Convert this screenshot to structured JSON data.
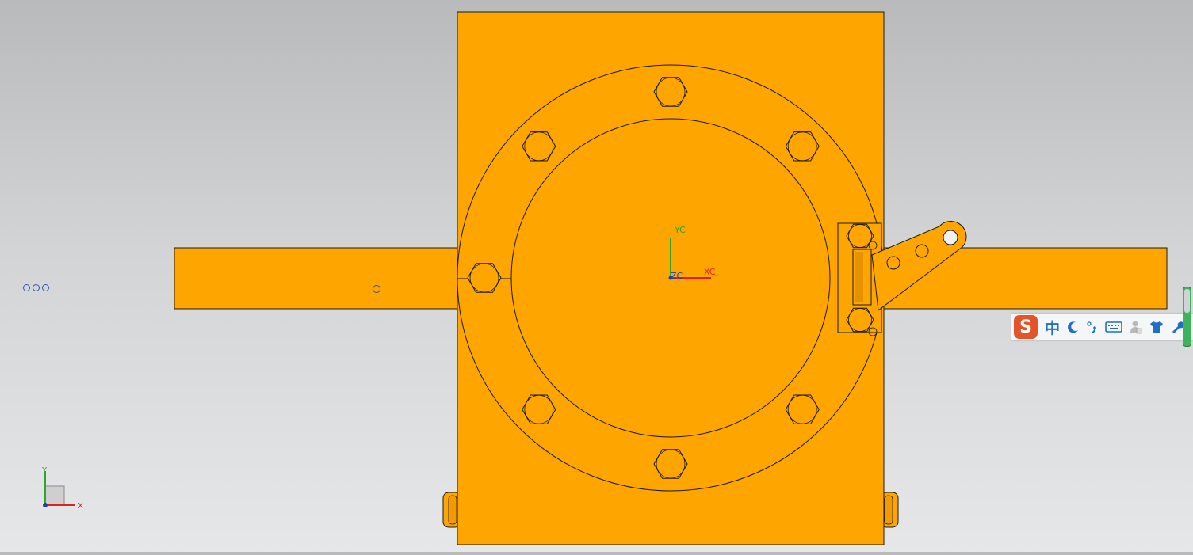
{
  "viewport": {
    "background_top": "#b9babb",
    "background_bottom": "#e6e7e8",
    "part_color": "#ffa500",
    "edge_color": "#1a1a1a"
  },
  "wcs_axes": {
    "x_label": "XC",
    "y_label": "YC",
    "z_label": "ZC",
    "x_color": "#e02020",
    "y_color": "#2ea62e",
    "z_color": "#1a3fb0"
  },
  "triad_axes": {
    "x_label": "X",
    "y_label": "Y"
  },
  "ime_toolbar": {
    "logo": "S",
    "lang": "中",
    "icons": [
      "moon-icon",
      "punctuation-icon",
      "keyboard-icon",
      "user-icon",
      "skin-shirt-icon",
      "wrench-icon"
    ]
  },
  "side_dots": {
    "count": 3
  }
}
